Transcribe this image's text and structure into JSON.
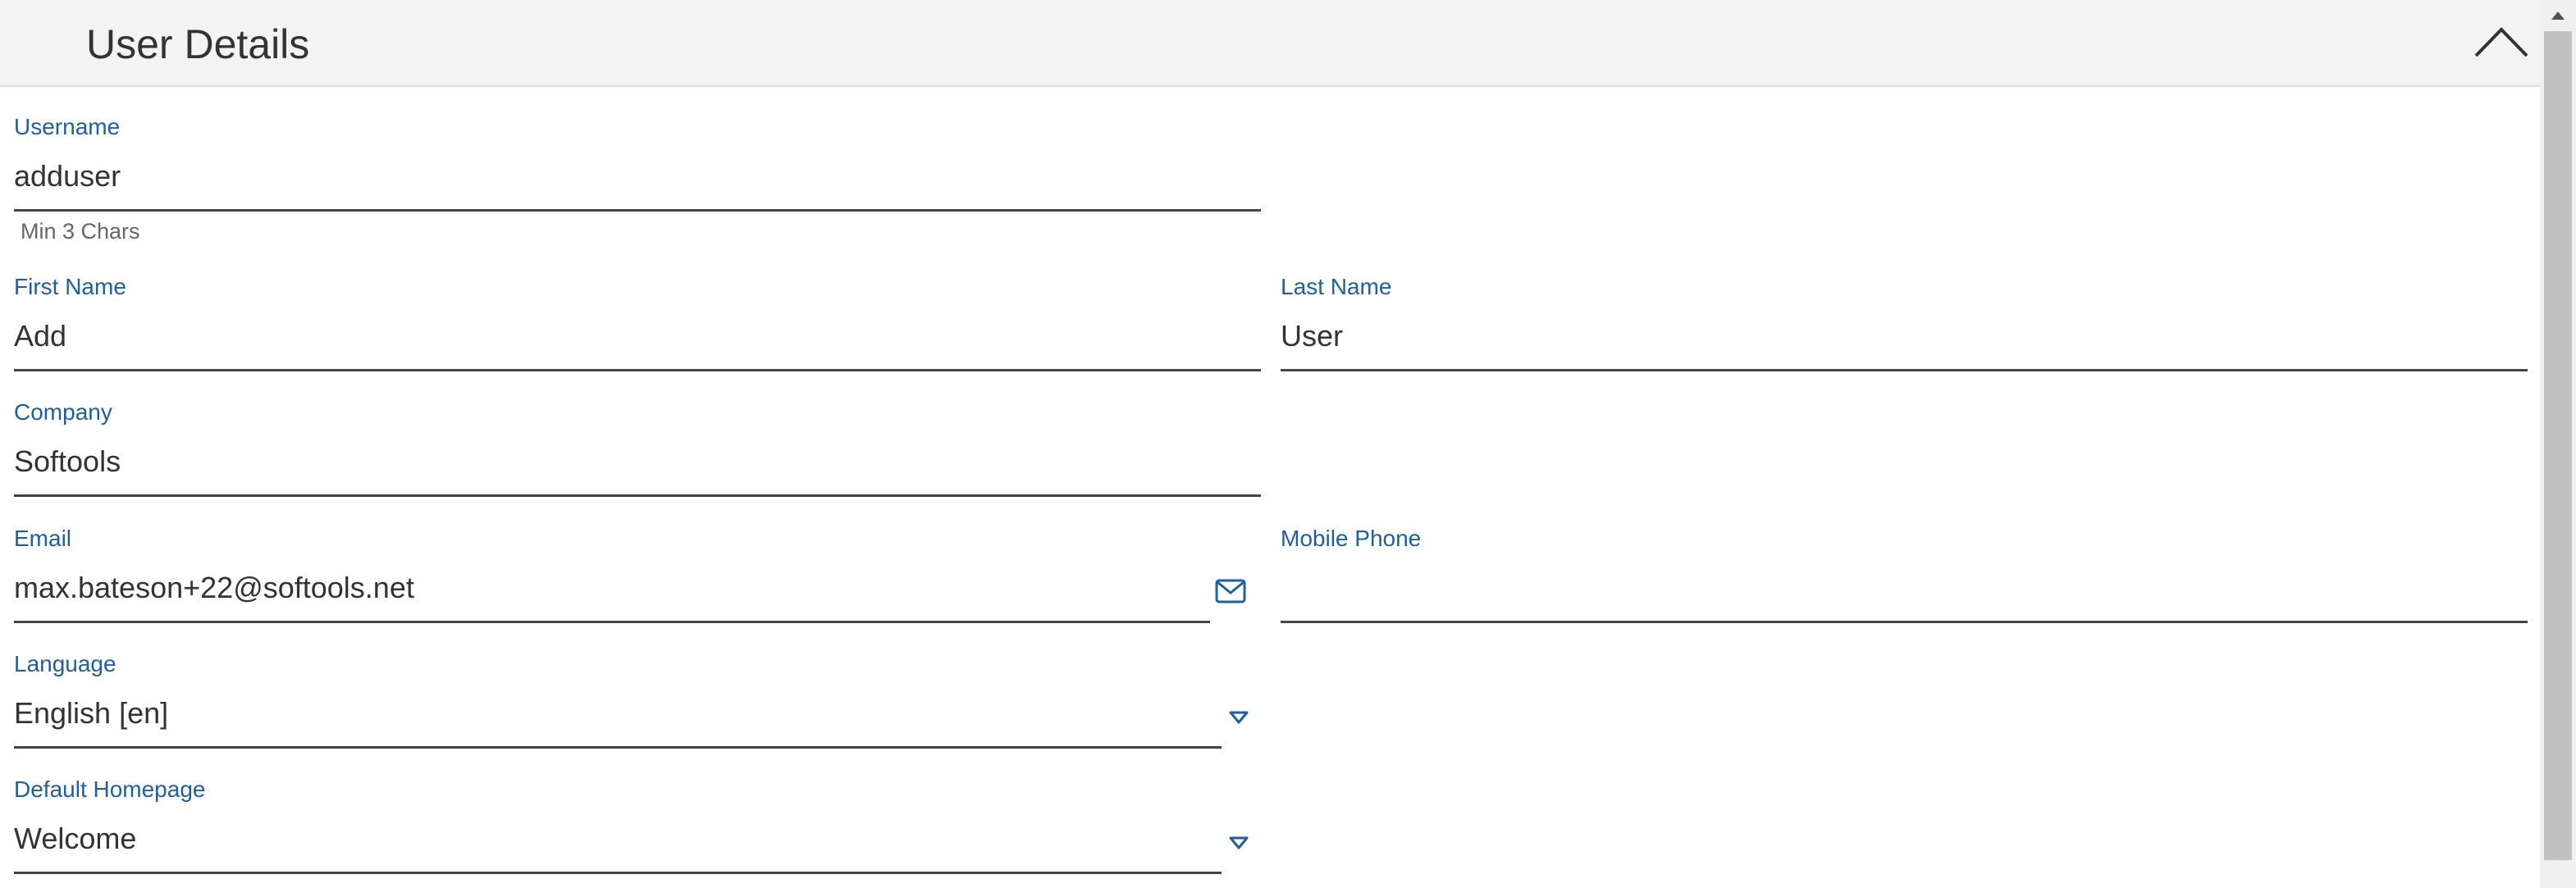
{
  "header": {
    "title": "User Details"
  },
  "fields": {
    "username": {
      "label": "Username",
      "value": "adduser",
      "hint": "Min 3 Chars"
    },
    "first_name": {
      "label": "First Name",
      "value": "Add"
    },
    "last_name": {
      "label": "Last Name",
      "value": "User"
    },
    "company": {
      "label": "Company",
      "value": "Softools"
    },
    "email": {
      "label": "Email",
      "value": "max.bateson+22@softools.net",
      "icon": "envelope-icon"
    },
    "mobile_phone": {
      "label": "Mobile Phone",
      "value": ""
    },
    "language": {
      "label": "Language",
      "value": "English [en]",
      "icon": "dropdown-triangle-icon"
    },
    "default_homepage": {
      "label": "Default Homepage",
      "value": "Welcome",
      "icon": "dropdown-triangle-icon"
    }
  },
  "colors": {
    "label": "#1f5fa0",
    "value": "#333333",
    "header_bg": "#f3f3f3"
  }
}
